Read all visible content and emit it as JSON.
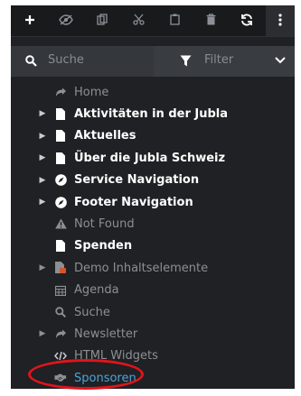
{
  "toolbar": {
    "buttons": [
      {
        "name": "add-icon",
        "glyph": "+"
      },
      {
        "name": "hide-icon",
        "glyph": "👁"
      },
      {
        "name": "copy-icon",
        "glyph": "⧉"
      },
      {
        "name": "cut-icon",
        "glyph": "✂"
      },
      {
        "name": "paste-icon",
        "glyph": "📋"
      },
      {
        "name": "delete-icon",
        "glyph": "🗑"
      },
      {
        "name": "refresh-icon",
        "glyph": "⟳"
      },
      {
        "name": "more-icon",
        "glyph": "⋮"
      }
    ]
  },
  "filterbar": {
    "search_placeholder": "Suche",
    "filter_placeholder": "Filter"
  },
  "tree": {
    "items": [
      {
        "label": "Home",
        "icon": "redirect-icon",
        "style": "dim",
        "expandable": false
      },
      {
        "label": "Aktivitäten in der Jubla",
        "icon": "page-icon",
        "style": "bright",
        "expandable": true
      },
      {
        "label": "Aktuelles",
        "icon": "page-icon",
        "style": "bright",
        "expandable": true
      },
      {
        "label": "Über die Jubla Schweiz",
        "icon": "page-icon",
        "style": "bright",
        "expandable": true
      },
      {
        "label": "Service Navigation",
        "icon": "compass-icon",
        "style": "bright",
        "expandable": true
      },
      {
        "label": "Footer Navigation",
        "icon": "compass-icon",
        "style": "bright",
        "expandable": true
      },
      {
        "label": "Not Found",
        "icon": "warning-icon",
        "style": "dim",
        "expandable": false
      },
      {
        "label": "Spenden",
        "icon": "page-icon",
        "style": "bright",
        "expandable": false
      },
      {
        "label": "Demo Inhaltselemente",
        "icon": "page-locked-icon",
        "style": "dim",
        "expandable": true
      },
      {
        "label": "Agenda",
        "icon": "calendar-icon",
        "style": "dim",
        "expandable": false
      },
      {
        "label": "Suche",
        "icon": "search-icon",
        "style": "dim",
        "expandable": false
      },
      {
        "label": "Newsletter",
        "icon": "redirect-icon",
        "style": "dim",
        "expandable": true
      },
      {
        "label": "HTML Widgets",
        "icon": "code-icon",
        "style": "dim",
        "expandable": false
      },
      {
        "label": "Sponsoren",
        "icon": "handshake-icon",
        "style": "link",
        "expandable": false
      }
    ]
  },
  "colors": {
    "panel_bg": "#1f2124",
    "toolbar_bg": "#191a1c",
    "filterbar_bg": "#34373b",
    "link": "#4da3d8",
    "highlight_ring": "#e0141c"
  }
}
